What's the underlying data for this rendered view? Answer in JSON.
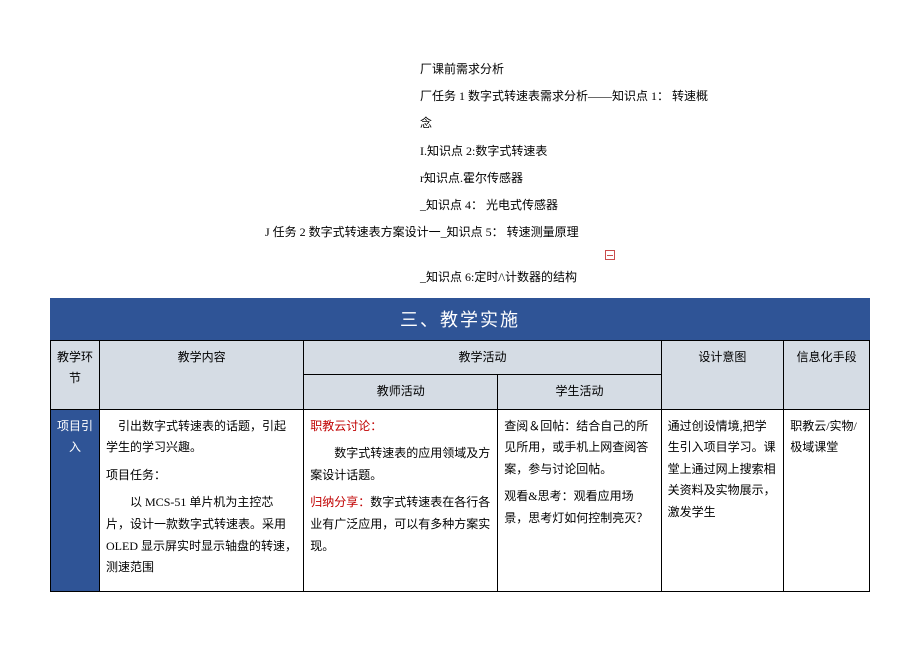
{
  "knowledge": {
    "line1": "厂课前需求分析",
    "line2a": "厂任务 1 数字式转速表需求分析——知识点 1： 转速概",
    "line2b": "念",
    "line3": "I.知识点 2:数字式转速表",
    "line4": "r知识点.霍尔传感器",
    "line5": "_知识点 4： 光电式传感器",
    "line6": "J 任务 2 数字式转速表方案设计一_知识点 5： 转速测量原理",
    "line7": "_知识点 6:定时/\\计数器的结构"
  },
  "section_title": "三、教学实施",
  "headers": {
    "col1": "教学环节",
    "col2": "教学内容",
    "col3": "教学活动",
    "col3a": "教师活动",
    "col3b": "学生活动",
    "col4": "设计意图",
    "col5": "信息化手段"
  },
  "row1": {
    "stage": "项目引入",
    "content_p1": "引出数字式转速表的话题，引起学生的学习兴趣。",
    "content_p2": "项目任务：",
    "content_p3": "以 MCS-51 单片机为主控芯片，设计一款数字式转速表。采用 OLED 显示屏实时显示轴盘的转速，测速范围",
    "teacher_h1": "职教云讨论：",
    "teacher_p1": "数字式转速表的应用领域及方案设计话题。",
    "teacher_h2": "归纳分享：",
    "teacher_p2": "数字式转速表在各行各业有广泛应用，可以有多种方案实现。",
    "student_p1": "查阅＆回帖：结合自己的所见所用，或手机上网查阅答案，参与讨论回帖。",
    "student_p2": "观看&思考：观看应用场景，思考灯如何控制亮灭？",
    "intent": "通过创设情境,把学生引入项目学习。课堂上通过网上搜索相关资料及实物展示，激发学生",
    "tools": "职教云/实物/极域课堂"
  }
}
